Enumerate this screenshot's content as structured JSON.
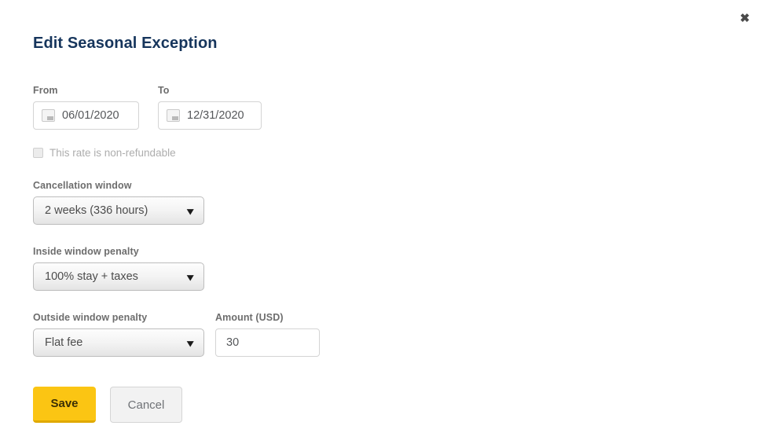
{
  "dialog": {
    "title": "Edit Seasonal Exception",
    "close_label": "✖"
  },
  "colors": {
    "title": "#16355c",
    "save_button": "#fbc513",
    "save_button_shadow": "#e0a900",
    "cancel_button": "#f2f2f2",
    "label_text": "#6d6d6d",
    "disabled_text": "#adadad"
  },
  "fields": {
    "from": {
      "label": "From",
      "value": "06/01/2020",
      "icon": "calendar-icon"
    },
    "to": {
      "label": "To",
      "value": "12/31/2020",
      "icon": "calendar-icon"
    },
    "non_refundable": {
      "label": "This rate is non-refundable",
      "checked": false,
      "disabled": true
    },
    "cancellation_window": {
      "label": "Cancellation window",
      "value": "2 weeks (336 hours)"
    },
    "inside_window_penalty": {
      "label": "Inside window penalty",
      "value": "100% stay + taxes"
    },
    "outside_window_penalty": {
      "label": "Outside window penalty",
      "value": "Flat fee"
    },
    "amount": {
      "label": "Amount (USD)",
      "value": "30"
    }
  },
  "icons": {
    "chevron_down": "⌄",
    "chevron_down_glyph": "▾"
  },
  "buttons": {
    "save": "Save",
    "cancel": "Cancel"
  }
}
